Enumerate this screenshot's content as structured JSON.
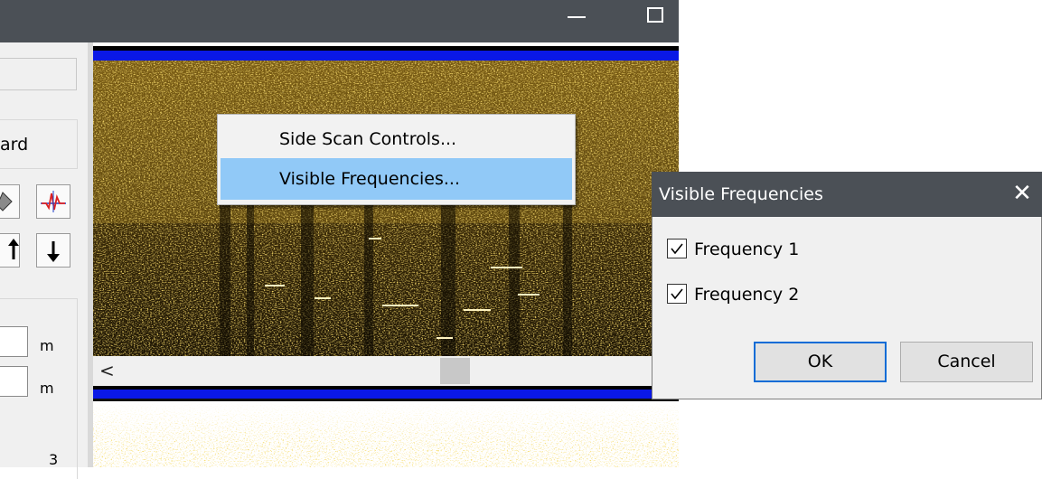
{
  "window": {
    "minimize_icon": "minimize-icon",
    "maximize_icon": "maximize-icon"
  },
  "left_panel": {
    "group_label": "ard",
    "tool_icons": [
      "eraser-icon",
      "waveform-icon",
      "arrow-up-icon",
      "arrow-down-icon"
    ],
    "unit_1": "m",
    "unit_2": "m",
    "bottom_text": "3"
  },
  "sonar": {
    "scroll_left_icon": "<",
    "colors": {
      "blue_band": "#0a18e6",
      "sonar_gold": "#e8b020"
    }
  },
  "context_menu": {
    "items": [
      {
        "label": "Side Scan Controls..."
      },
      {
        "label": "Visible Frequencies...",
        "highlighted": true
      }
    ]
  },
  "dialog": {
    "title": "Visible Frequencies",
    "close_icon": "close-icon",
    "checkboxes": [
      {
        "label": "Frequency 1",
        "checked": true
      },
      {
        "label": "Frequency 2",
        "checked": true
      }
    ],
    "ok_label": "OK",
    "cancel_label": "Cancel"
  }
}
